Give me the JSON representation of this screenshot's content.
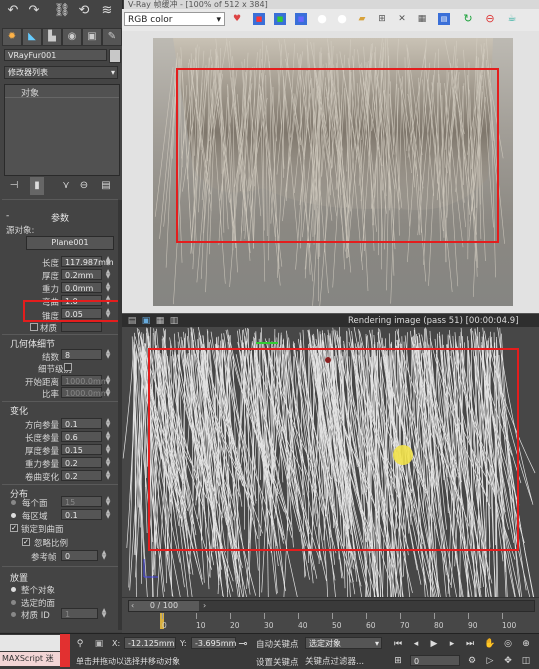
{
  "vfb": {
    "title": "V-Ray 帧缓冲 - [100% of 512 x 384]",
    "channel": "RGB color"
  },
  "rendering": {
    "status": "Rendering image (pass 51) [00:00:04.9]"
  },
  "panel": {
    "object_name": "VRayFur001",
    "modifier_list": "修改器列表",
    "stack_header": "对象",
    "params_title": "参数",
    "source_label": "源对象:",
    "source_value": "Plane001",
    "length_label": "长度",
    "length_value": "117.987mm",
    "thickness_label": "厚度",
    "thickness_value": "0.2mm",
    "gravity_label": "重力",
    "gravity_value": "0.0mm",
    "bend_label": "弯曲",
    "bend_value": "1.0",
    "taper_label": "锥度",
    "taper_value": "0.05",
    "material_label": "材质",
    "geom_title": "几何体细节",
    "knots_label": "结数",
    "knots_value": "8",
    "lod_label": "细节级别",
    "start_dist_label": "开始距离",
    "start_dist_value": "1000.0mm",
    "rate_label": "比率",
    "rate_value": "1000.0mm",
    "variation_title": "变化",
    "dir_var_label": "方向参量",
    "dir_var_value": "0.1",
    "len_var_label": "长度参量",
    "len_var_value": "0.6",
    "thick_var_label": "厚度参量",
    "thick_var_value": "0.15",
    "grav_var_label": "重力参量",
    "grav_var_value": "0.2",
    "curl_var_label": "卷曲变化",
    "curl_var_value": "0.2",
    "distribution_title": "分布",
    "per_face_label": "每个面",
    "per_face_value": "15",
    "per_area_label": "每区域",
    "per_area_value": "0.1",
    "lock_label": "锁定到曲面",
    "ignore_scale_label": "忽略比例",
    "ref_frame_label": "参考帧",
    "ref_frame_value": "0",
    "placement_title": "放置",
    "whole_object_label": "整个对象",
    "selected_faces_label": "选定的面",
    "material_id_label": "材质 ID",
    "material_id_value": "1"
  },
  "timeline": {
    "frame_display": "0 / 100",
    "ticks": [
      "0",
      "10",
      "20",
      "30",
      "40",
      "50",
      "60",
      "70",
      "80",
      "90",
      "100"
    ]
  },
  "statusbar": {
    "maxscript": "MAXScript 迷",
    "x_label": "X:",
    "x_value": "-12.125mm",
    "y_label": "Y:",
    "y_value": "-3.695mm",
    "autokey_label": "自动关键点",
    "selected_object": "选定对象",
    "setkey_label": "设置关键点",
    "keyfilter_label": "关键点过滤器...",
    "prompt": "单击并拖动以选择并移动对象",
    "frame_field": "0"
  },
  "colors": {
    "highlight_box": "#e41d1d",
    "panel_bg": "#444444",
    "vfb_bg": "#e2e2e2"
  }
}
